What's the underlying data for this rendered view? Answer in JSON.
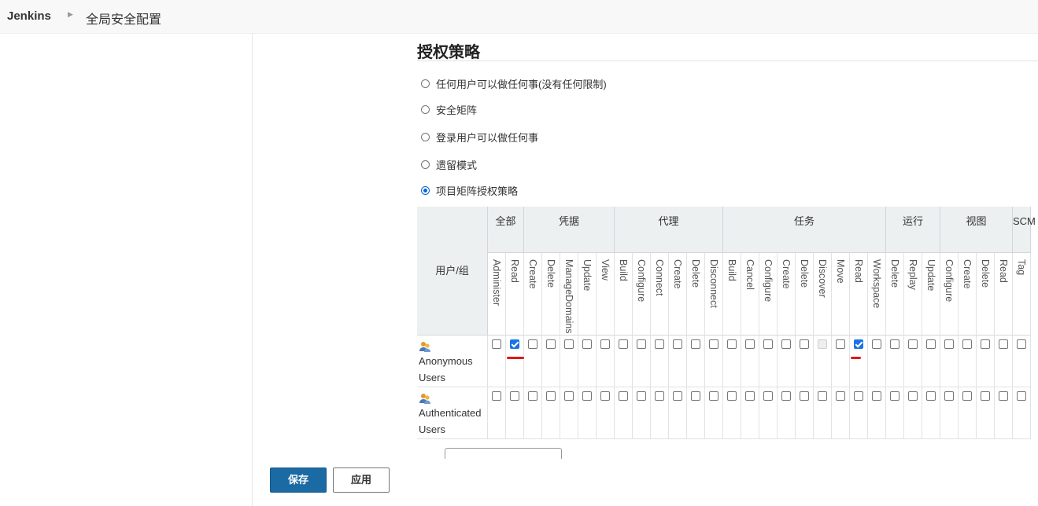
{
  "breadcrumb": {
    "root": "Jenkins",
    "separator": "›",
    "current": "全局安全配置"
  },
  "section": {
    "title": "授权策略"
  },
  "strategies": [
    {
      "label": "任何用户可以做任何事(没有任何限制)",
      "selected": false
    },
    {
      "label": "安全矩阵",
      "selected": false
    },
    {
      "label": "登录用户可以做任何事",
      "selected": false
    },
    {
      "label": "遗留模式",
      "selected": false
    },
    {
      "label": "项目矩阵授权策略",
      "selected": true
    }
  ],
  "matrix": {
    "user_header": "用户/组",
    "groups": [
      {
        "label": "全部",
        "permissions": [
          "Administer",
          "Read"
        ]
      },
      {
        "label": "凭据",
        "permissions": [
          "Create",
          "Delete",
          "ManageDomains",
          "Update",
          "View"
        ]
      },
      {
        "label": "代理",
        "permissions": [
          "Build",
          "Configure",
          "Connect",
          "Create",
          "Delete",
          "Disconnect"
        ]
      },
      {
        "label": "任务",
        "permissions": [
          "Build",
          "Cancel",
          "Configure",
          "Create",
          "Delete",
          "Discover",
          "Move",
          "Read",
          "Workspace"
        ]
      },
      {
        "label": "运行",
        "permissions": [
          "Delete",
          "Replay",
          "Update"
        ]
      },
      {
        "label": "视图",
        "permissions": [
          "Configure",
          "Create",
          "Delete",
          "Read"
        ]
      },
      {
        "label": "SCM",
        "permissions": [
          "Tag"
        ]
      }
    ],
    "rows": [
      {
        "user": "Anonymous Users",
        "checked": [
          false,
          true,
          false,
          false,
          false,
          false,
          false,
          false,
          false,
          false,
          false,
          false,
          false,
          false,
          false,
          false,
          false,
          false,
          false,
          false,
          true,
          false,
          false,
          false,
          false,
          false,
          false,
          false,
          false,
          false
        ],
        "disabled_index": 18
      },
      {
        "user": "Authenticated Users",
        "checked": [
          false,
          false,
          false,
          false,
          false,
          false,
          false,
          false,
          false,
          false,
          false,
          false,
          false,
          false,
          false,
          false,
          false,
          false,
          false,
          false,
          false,
          false,
          false,
          false,
          false,
          false,
          false,
          false,
          false,
          false
        ],
        "disabled_index": -1
      }
    ]
  },
  "buttons": {
    "save": "保存",
    "apply": "应用"
  },
  "colors": {
    "primary": "#1b6aa3",
    "checkbox_checked": "#1a73e8",
    "annotation_red": "#e01818"
  }
}
